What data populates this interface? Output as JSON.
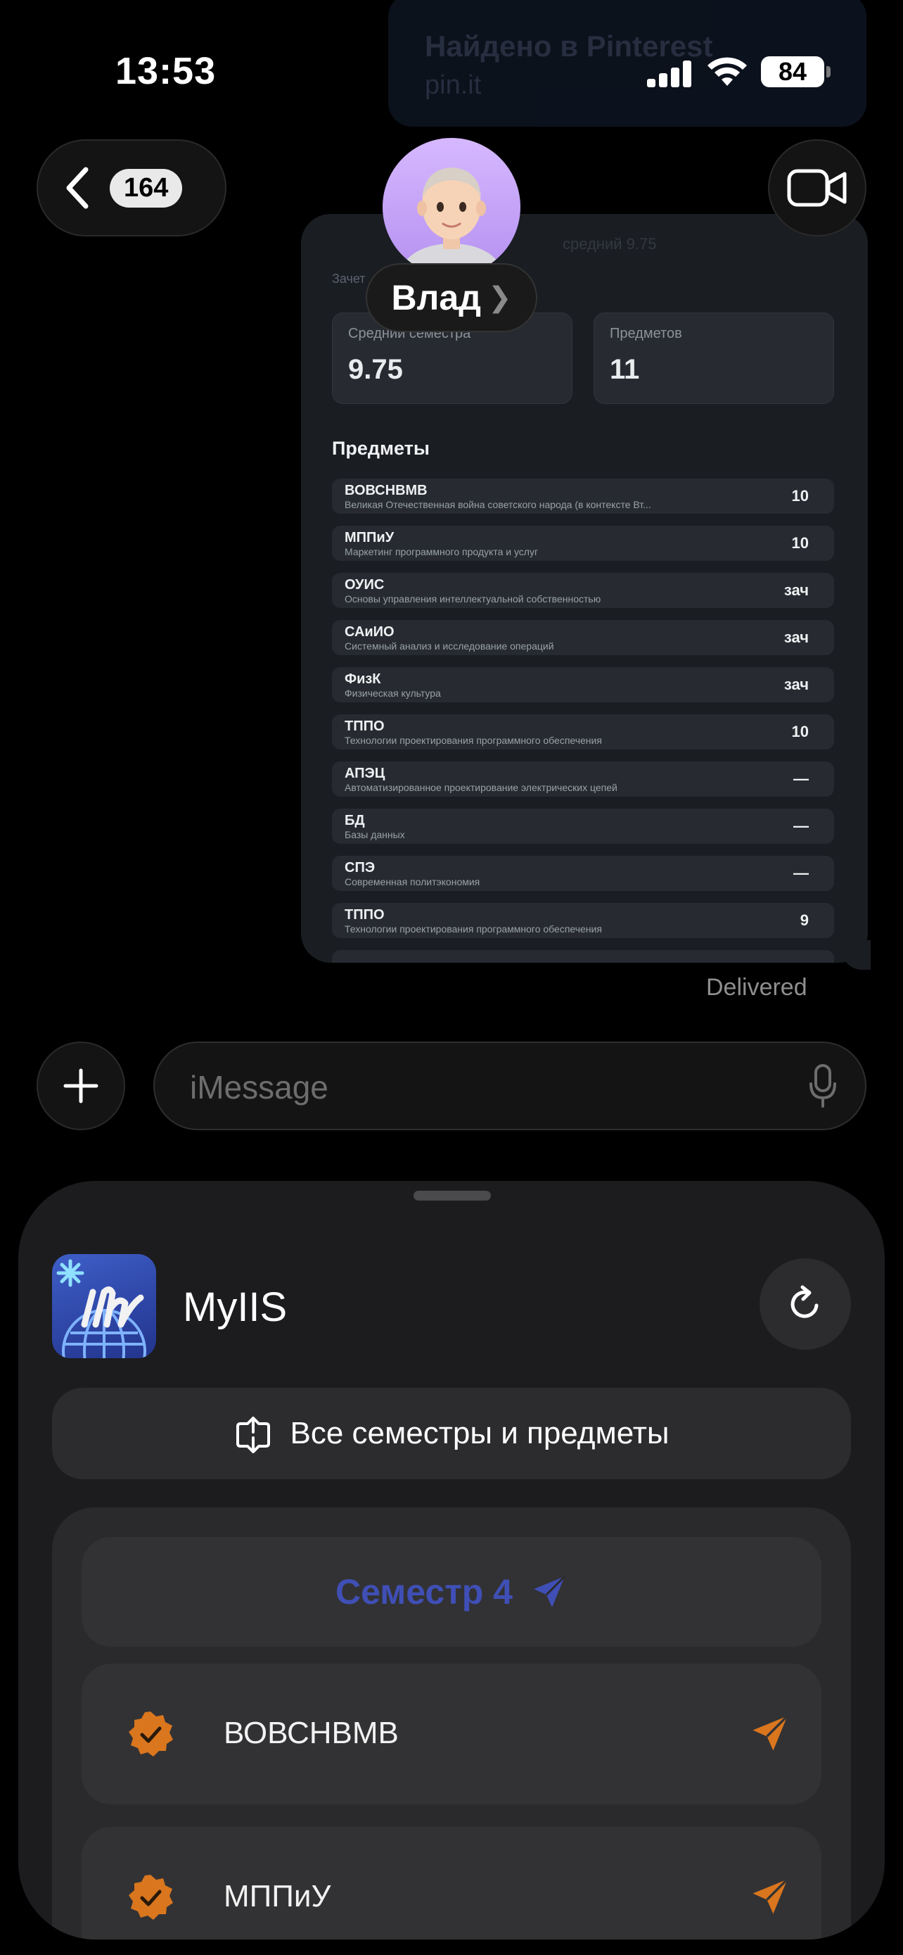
{
  "status_bar": {
    "time": "13:53",
    "battery": "84"
  },
  "notification": {
    "title": "Найдено в Pinterest",
    "subtitle": "pin.it"
  },
  "header": {
    "back_count": "164",
    "contact_name": "Влад"
  },
  "message": {
    "section_label": "Зачет",
    "faded_subtitle": "средний 9.75",
    "stats": [
      {
        "label": "Средний семестра",
        "value": "9.75"
      },
      {
        "label": "Предметов",
        "value": "11"
      }
    ],
    "subjects_title": "Предметы",
    "subjects": [
      {
        "code": "ВОВСНВМВ",
        "name": "Великая Отечественная война советского народа (в контексте Вт...",
        "grade": "10"
      },
      {
        "code": "МППиУ",
        "name": "Маркетинг программного продукта и услуг",
        "grade": "10"
      },
      {
        "code": "ОУИС",
        "name": "Основы управления интеллектуальной собственностью",
        "grade": "зач"
      },
      {
        "code": "САиИО",
        "name": "Системный анализ и исследование операций",
        "grade": "зач"
      },
      {
        "code": "ФизК",
        "name": "Физическая культура",
        "grade": "зач"
      },
      {
        "code": "ТППО",
        "name": "Технологии проектирования программного обеспечения",
        "grade": "10"
      },
      {
        "code": "АПЭЦ",
        "name": "Автоматизированное проектирование электрических цепей",
        "grade": "—"
      },
      {
        "code": "БД",
        "name": "Базы данных",
        "grade": "—"
      },
      {
        "code": "СПЭ",
        "name": "Современная политэкономия",
        "grade": "—"
      },
      {
        "code": "ТППО",
        "name": "Технологии проектирования программного обеспечения",
        "grade": "9"
      }
    ],
    "status": "Delivered"
  },
  "composer": {
    "placeholder": "iMessage"
  },
  "app_sheet": {
    "app_name": "MyIIS",
    "all_button_label": "Все семестры и предметы",
    "semester_label": "Семестр 4",
    "items": [
      {
        "label": "ВОВСНВМВ"
      },
      {
        "label": "МППиУ"
      }
    ],
    "colors": {
      "accent_blue": "#3f4fb5",
      "accent_orange": "#d9761e"
    }
  }
}
